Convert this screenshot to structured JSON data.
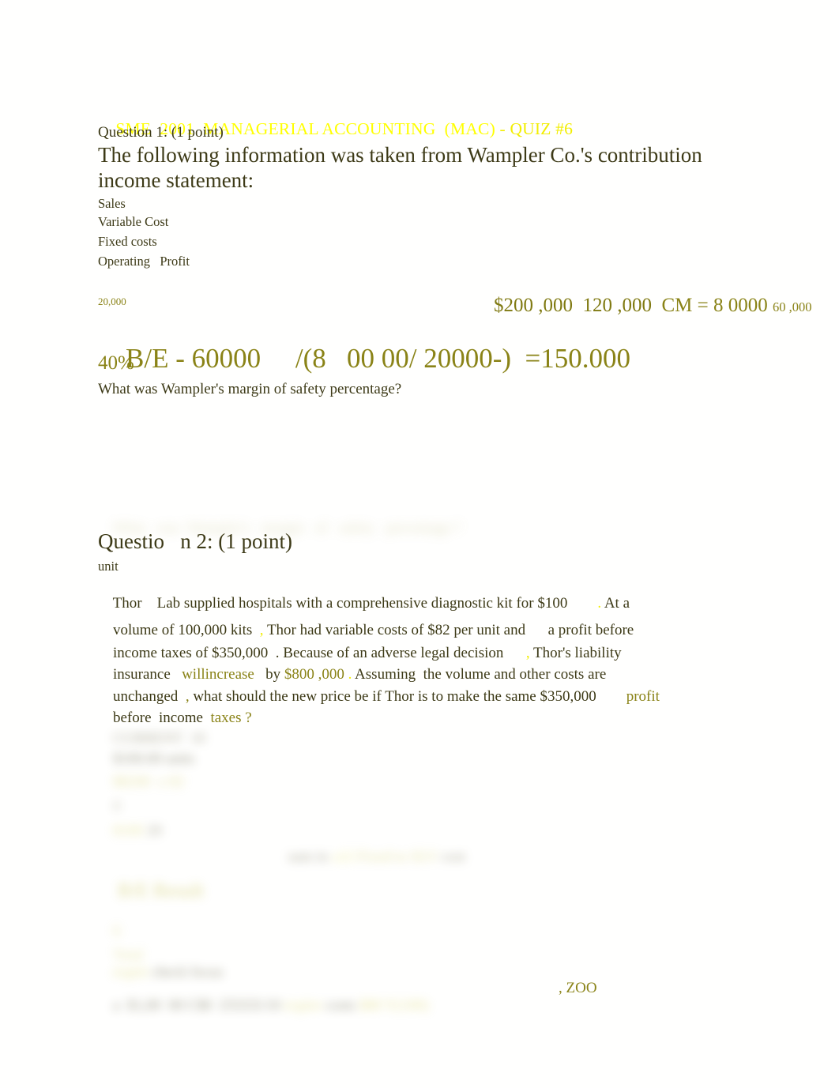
{
  "document": {
    "type": "quiz-worksheet",
    "page_background": "#ffffff",
    "text_color_primary": "#3d3a17",
    "text_color_accent": "#8a8317",
    "text_color_highlight": "#ffff00"
  },
  "header": {
    "course_code": "SME  2001",
    "course_name": "MANAGERIAL ACCOUNTING  (MAC)",
    "quiz_label": "- QUIZ #6",
    "full_title": "SME  2001  MANAGERIAL ACCOUNTING  (MAC) - QUIZ #6"
  },
  "question1": {
    "label": "Question 1: (1 point)",
    "prompt_line1": "The following information was taken from Wampler Co.'s contribution",
    "prompt_line2": "income statement:",
    "statement_rows": [
      {
        "label": "Sales"
      },
      {
        "label": "Variable Cost"
      },
      {
        "label": "Fixed costs"
      },
      {
        "label": "Operating   Profit"
      }
    ],
    "figures": {
      "sales": "$200 ,000",
      "variable_cost": "120 ,000",
      "cm_label": "CM = 8 0000",
      "cm_small": "60 ,000",
      "operating_profit": "20,000"
    },
    "handwritten_work": {
      "be_line_1": "B/E - 60000",
      "be_line_2": "/(8   00 00/ 20000-)",
      "be_line_3": "=150.000",
      "be_line_4": "40%"
    },
    "question_text": "What was Wampler's margin of safety percentage?"
  },
  "question2": {
    "label": "Questio   n 2: (1 point)",
    "sublabel": "unit",
    "body": {
      "l1_a": "Thor    Lab supplied hospitals with a comprehensive diagnostic kit for $100",
      "l1_dot": ".",
      "l1_b": " At a",
      "l2_a": "volume of 100,000 kits",
      "l2_comma": ",",
      "l2_b": " Thor had variable costs of $82 per unit and",
      "l2_c": "a profit before",
      "l3_a": "income taxes of $350,000",
      "l3_b": ". Because of an adverse legal decision",
      "l3_comma": ",",
      "l3_c": " Thor's liability",
      "l4_a": "insurance",
      "l4_b": "willincrease",
      "l4_c": "by",
      "l4_d": "$800 ,000",
      "l4_dot": ".",
      "l4_e": " Assuming",
      "l4_f": "  the volume and other costs are",
      "l5_a": "unchanged",
      "l5_comma": ",",
      "l5_b": " what should the new price be if Thor is to make the same $350,000",
      "l5_c": "profit",
      "l6_a": "before",
      "l6_b": "  income",
      "l6_c": "  taxes",
      "l6_q": "?"
    },
    "trailing_fragment": ", ZOO"
  },
  "illegible_regions": [
    {
      "id": "faded-row-below-q1",
      "note": "heavily faded horizontal line of text above Question 2"
    },
    {
      "id": "blurred-work-block-1",
      "note": "blurred handwritten working below Question 2"
    },
    {
      "id": "blurred-work-block-2",
      "note": "blurred handwritten working, mid page"
    },
    {
      "id": "blurred-work-block-3",
      "note": "blurred handwritten working, lower page"
    },
    {
      "id": "blurred-final-line",
      "note": "blurred line preceding the readable ', ZOO' fragment"
    }
  ]
}
